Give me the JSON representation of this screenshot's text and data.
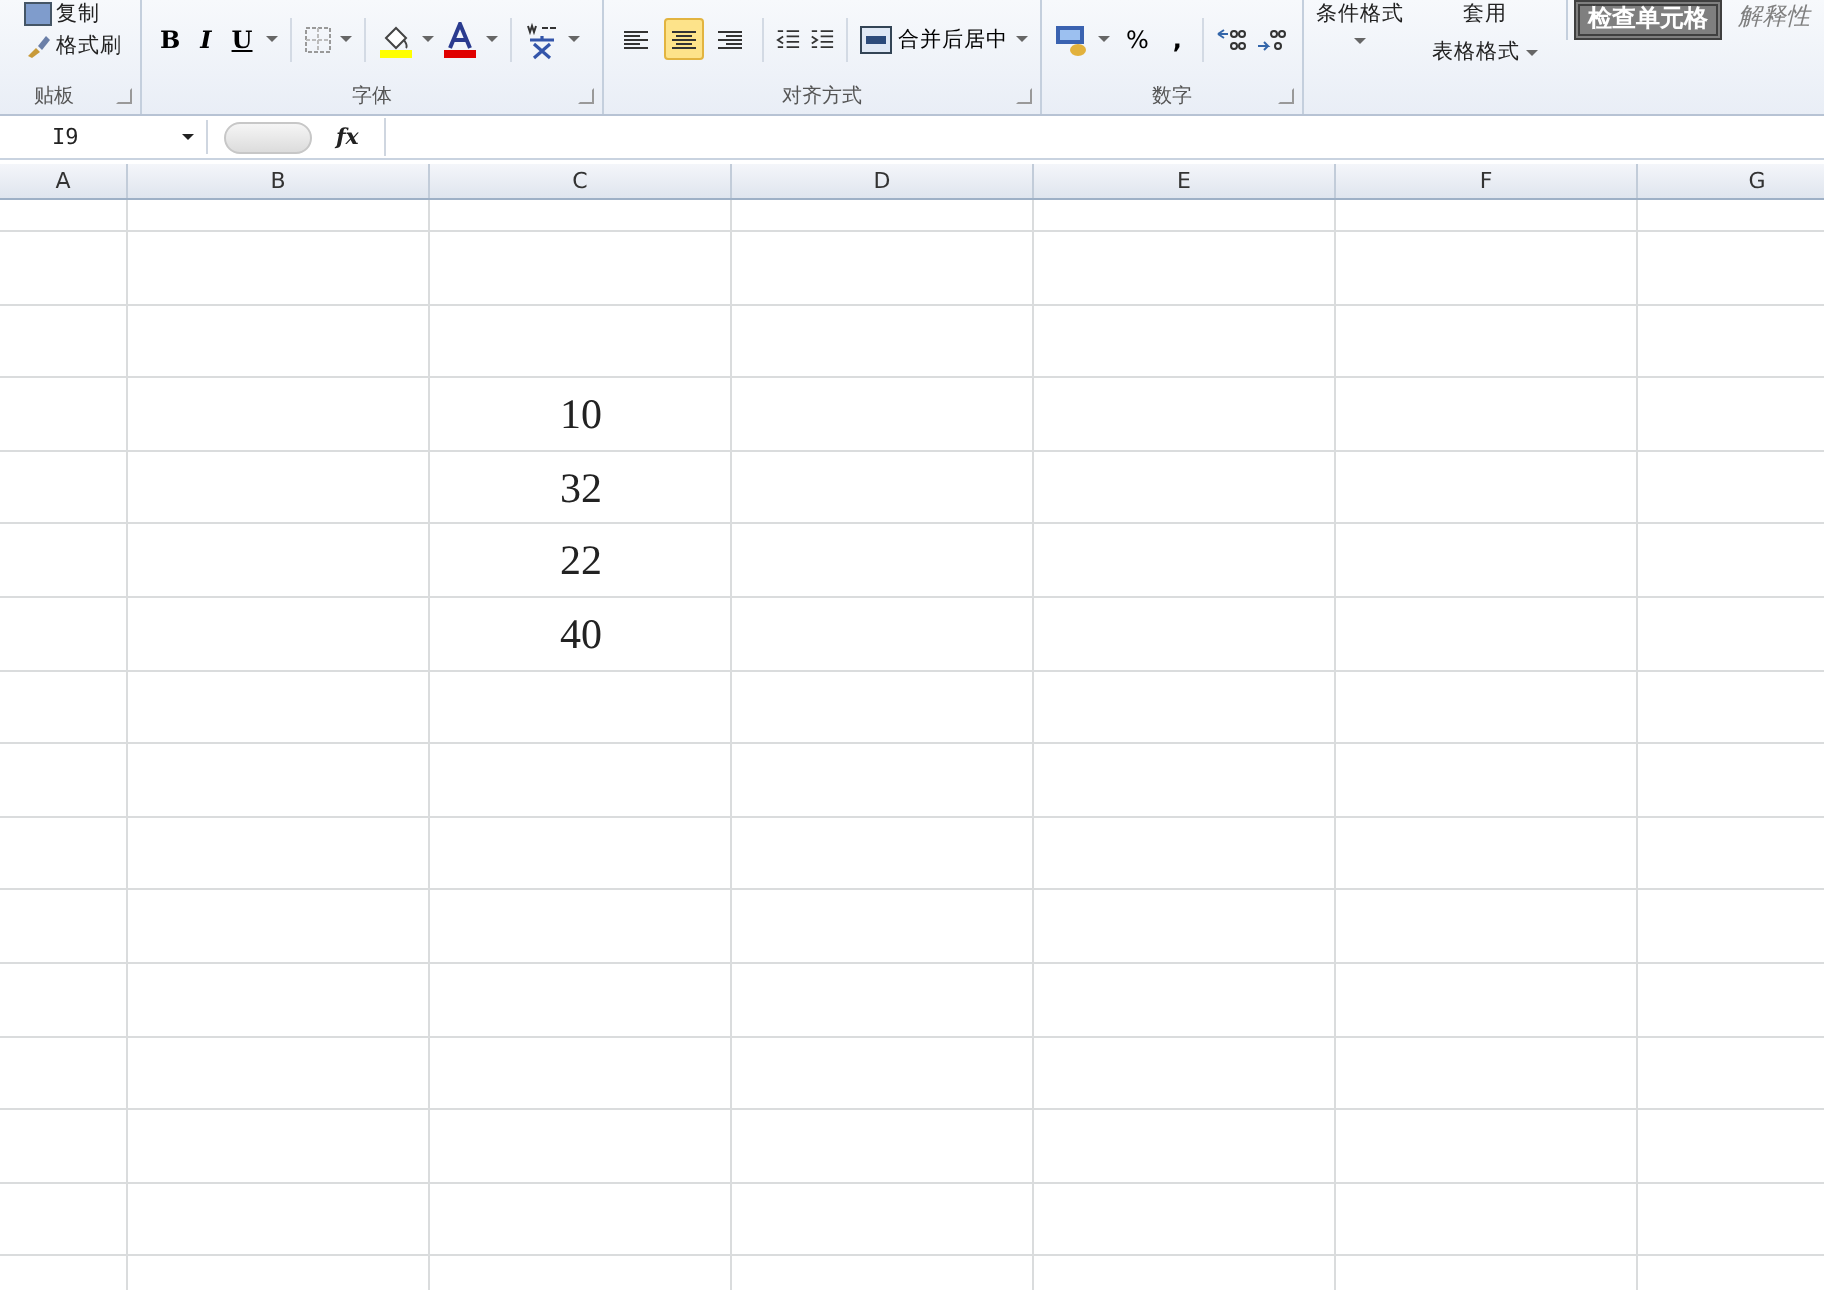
{
  "ribbon": {
    "clipboard": {
      "copy_label": "复制",
      "format_painter_label": "格式刷",
      "group_label": "贴板"
    },
    "font": {
      "group_label": "字体",
      "buttons": [
        {
          "label": "B",
          "kind": "bold",
          "dropdown": false
        },
        {
          "label": "I",
          "kind": "italic",
          "dropdown": false
        },
        {
          "label": "U",
          "kind": "underline",
          "dropdown": true
        }
      ]
    },
    "alignment": {
      "group_label": "对齐方式",
      "align_buttons": [
        {
          "kind": "left",
          "selected": false
        },
        {
          "kind": "center",
          "selected": true
        },
        {
          "kind": "right",
          "selected": false
        }
      ],
      "merge_label": "合并后居中"
    },
    "number": {
      "group_label": "数字",
      "percent_label": "%",
      "comma_label": ","
    },
    "styles": {
      "conditional_label": "条件格式",
      "table_label_top": "套用",
      "table_label_bottom": "表格格式",
      "style_cells": [
        {
          "label": "检查单元格",
          "kind": "check"
        },
        {
          "label": "解释性",
          "kind": "explanatory"
        }
      ]
    }
  },
  "formula_bar": {
    "name_box": "I9",
    "fx_label": "fx"
  },
  "sheet": {
    "columns": [
      "A",
      "B",
      "C",
      "D",
      "E",
      "F",
      "G"
    ],
    "column_c_values": [
      "10",
      "32",
      "22",
      "40"
    ]
  }
}
